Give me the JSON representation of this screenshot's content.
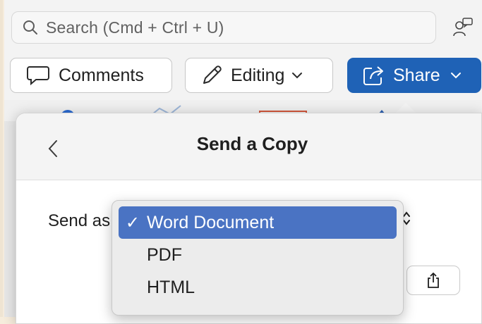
{
  "search": {
    "placeholder": "Search (Cmd + Ctrl + U)"
  },
  "toolbar": {
    "comments_label": "Comments",
    "editing_label": "Editing",
    "share_label": "Share",
    "share_color": "#1f62b6"
  },
  "panel": {
    "title": "Send a Copy",
    "send_as_label": "Send as"
  },
  "dropdown": {
    "options": [
      {
        "label": "Word Document",
        "selected": true,
        "check": "✓"
      },
      {
        "label": "PDF",
        "selected": false,
        "check": ""
      },
      {
        "label": "HTML",
        "selected": false,
        "check": ""
      }
    ],
    "highlight_color": "#4a73c3"
  },
  "icons": {
    "search": "search-icon",
    "people": "people-icon",
    "comments": "comment-icon",
    "editing": "pencil-icon",
    "share": "share-icon",
    "back": "chevron-left-icon",
    "export": "share-export-icon"
  }
}
